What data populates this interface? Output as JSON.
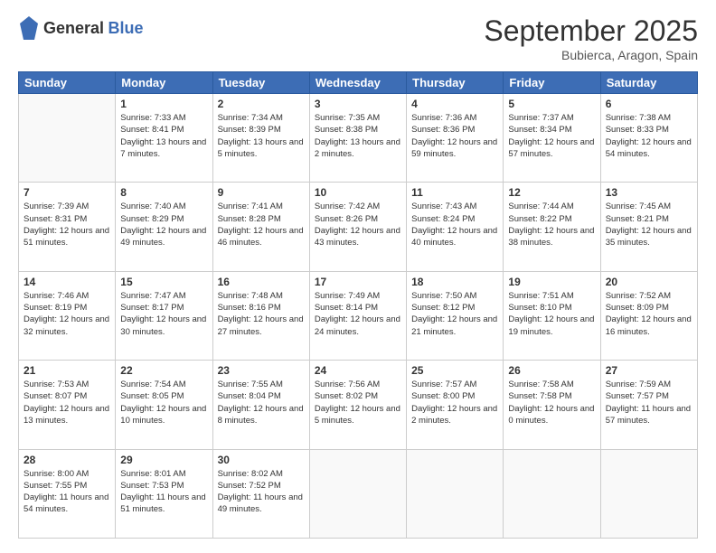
{
  "logo": {
    "line1": "General",
    "line2": "Blue"
  },
  "header": {
    "month": "September 2025",
    "location": "Bubierca, Aragon, Spain"
  },
  "days_of_week": [
    "Sunday",
    "Monday",
    "Tuesday",
    "Wednesday",
    "Thursday",
    "Friday",
    "Saturday"
  ],
  "weeks": [
    [
      {
        "day": "",
        "sunrise": "",
        "sunset": "",
        "daylight": ""
      },
      {
        "day": "1",
        "sunrise": "Sunrise: 7:33 AM",
        "sunset": "Sunset: 8:41 PM",
        "daylight": "Daylight: 13 hours and 7 minutes."
      },
      {
        "day": "2",
        "sunrise": "Sunrise: 7:34 AM",
        "sunset": "Sunset: 8:39 PM",
        "daylight": "Daylight: 13 hours and 5 minutes."
      },
      {
        "day": "3",
        "sunrise": "Sunrise: 7:35 AM",
        "sunset": "Sunset: 8:38 PM",
        "daylight": "Daylight: 13 hours and 2 minutes."
      },
      {
        "day": "4",
        "sunrise": "Sunrise: 7:36 AM",
        "sunset": "Sunset: 8:36 PM",
        "daylight": "Daylight: 12 hours and 59 minutes."
      },
      {
        "day": "5",
        "sunrise": "Sunrise: 7:37 AM",
        "sunset": "Sunset: 8:34 PM",
        "daylight": "Daylight: 12 hours and 57 minutes."
      },
      {
        "day": "6",
        "sunrise": "Sunrise: 7:38 AM",
        "sunset": "Sunset: 8:33 PM",
        "daylight": "Daylight: 12 hours and 54 minutes."
      }
    ],
    [
      {
        "day": "7",
        "sunrise": "Sunrise: 7:39 AM",
        "sunset": "Sunset: 8:31 PM",
        "daylight": "Daylight: 12 hours and 51 minutes."
      },
      {
        "day": "8",
        "sunrise": "Sunrise: 7:40 AM",
        "sunset": "Sunset: 8:29 PM",
        "daylight": "Daylight: 12 hours and 49 minutes."
      },
      {
        "day": "9",
        "sunrise": "Sunrise: 7:41 AM",
        "sunset": "Sunset: 8:28 PM",
        "daylight": "Daylight: 12 hours and 46 minutes."
      },
      {
        "day": "10",
        "sunrise": "Sunrise: 7:42 AM",
        "sunset": "Sunset: 8:26 PM",
        "daylight": "Daylight: 12 hours and 43 minutes."
      },
      {
        "day": "11",
        "sunrise": "Sunrise: 7:43 AM",
        "sunset": "Sunset: 8:24 PM",
        "daylight": "Daylight: 12 hours and 40 minutes."
      },
      {
        "day": "12",
        "sunrise": "Sunrise: 7:44 AM",
        "sunset": "Sunset: 8:22 PM",
        "daylight": "Daylight: 12 hours and 38 minutes."
      },
      {
        "day": "13",
        "sunrise": "Sunrise: 7:45 AM",
        "sunset": "Sunset: 8:21 PM",
        "daylight": "Daylight: 12 hours and 35 minutes."
      }
    ],
    [
      {
        "day": "14",
        "sunrise": "Sunrise: 7:46 AM",
        "sunset": "Sunset: 8:19 PM",
        "daylight": "Daylight: 12 hours and 32 minutes."
      },
      {
        "day": "15",
        "sunrise": "Sunrise: 7:47 AM",
        "sunset": "Sunset: 8:17 PM",
        "daylight": "Daylight: 12 hours and 30 minutes."
      },
      {
        "day": "16",
        "sunrise": "Sunrise: 7:48 AM",
        "sunset": "Sunset: 8:16 PM",
        "daylight": "Daylight: 12 hours and 27 minutes."
      },
      {
        "day": "17",
        "sunrise": "Sunrise: 7:49 AM",
        "sunset": "Sunset: 8:14 PM",
        "daylight": "Daylight: 12 hours and 24 minutes."
      },
      {
        "day": "18",
        "sunrise": "Sunrise: 7:50 AM",
        "sunset": "Sunset: 8:12 PM",
        "daylight": "Daylight: 12 hours and 21 minutes."
      },
      {
        "day": "19",
        "sunrise": "Sunrise: 7:51 AM",
        "sunset": "Sunset: 8:10 PM",
        "daylight": "Daylight: 12 hours and 19 minutes."
      },
      {
        "day": "20",
        "sunrise": "Sunrise: 7:52 AM",
        "sunset": "Sunset: 8:09 PM",
        "daylight": "Daylight: 12 hours and 16 minutes."
      }
    ],
    [
      {
        "day": "21",
        "sunrise": "Sunrise: 7:53 AM",
        "sunset": "Sunset: 8:07 PM",
        "daylight": "Daylight: 12 hours and 13 minutes."
      },
      {
        "day": "22",
        "sunrise": "Sunrise: 7:54 AM",
        "sunset": "Sunset: 8:05 PM",
        "daylight": "Daylight: 12 hours and 10 minutes."
      },
      {
        "day": "23",
        "sunrise": "Sunrise: 7:55 AM",
        "sunset": "Sunset: 8:04 PM",
        "daylight": "Daylight: 12 hours and 8 minutes."
      },
      {
        "day": "24",
        "sunrise": "Sunrise: 7:56 AM",
        "sunset": "Sunset: 8:02 PM",
        "daylight": "Daylight: 12 hours and 5 minutes."
      },
      {
        "day": "25",
        "sunrise": "Sunrise: 7:57 AM",
        "sunset": "Sunset: 8:00 PM",
        "daylight": "Daylight: 12 hours and 2 minutes."
      },
      {
        "day": "26",
        "sunrise": "Sunrise: 7:58 AM",
        "sunset": "Sunset: 7:58 PM",
        "daylight": "Daylight: 12 hours and 0 minutes."
      },
      {
        "day": "27",
        "sunrise": "Sunrise: 7:59 AM",
        "sunset": "Sunset: 7:57 PM",
        "daylight": "Daylight: 11 hours and 57 minutes."
      }
    ],
    [
      {
        "day": "28",
        "sunrise": "Sunrise: 8:00 AM",
        "sunset": "Sunset: 7:55 PM",
        "daylight": "Daylight: 11 hours and 54 minutes."
      },
      {
        "day": "29",
        "sunrise": "Sunrise: 8:01 AM",
        "sunset": "Sunset: 7:53 PM",
        "daylight": "Daylight: 11 hours and 51 minutes."
      },
      {
        "day": "30",
        "sunrise": "Sunrise: 8:02 AM",
        "sunset": "Sunset: 7:52 PM",
        "daylight": "Daylight: 11 hours and 49 minutes."
      },
      {
        "day": "",
        "sunrise": "",
        "sunset": "",
        "daylight": ""
      },
      {
        "day": "",
        "sunrise": "",
        "sunset": "",
        "daylight": ""
      },
      {
        "day": "",
        "sunrise": "",
        "sunset": "",
        "daylight": ""
      },
      {
        "day": "",
        "sunrise": "",
        "sunset": "",
        "daylight": ""
      }
    ]
  ]
}
